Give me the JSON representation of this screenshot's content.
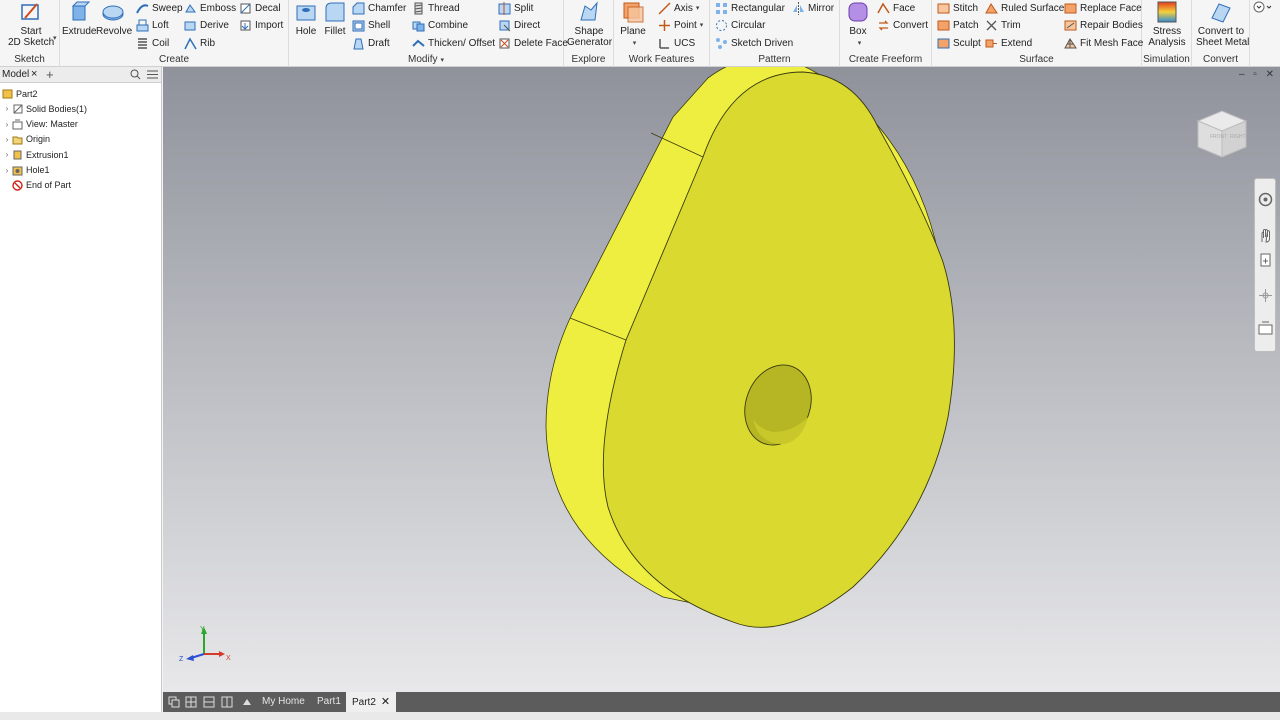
{
  "ribbon": {
    "sketch": {
      "title": "Sketch",
      "start_sketch": [
        "Start",
        "2D Sketch"
      ]
    },
    "create": {
      "title": "Create",
      "extrude": "Extrude",
      "revolve": "Revolve",
      "sweep": "Sweep",
      "loft": "Loft",
      "coil": "Coil",
      "emboss": "Emboss",
      "derive": "Derive",
      "rib": "Rib",
      "decal": "Decal",
      "import": "Import"
    },
    "modify": {
      "title": "Modify",
      "hole": "Hole",
      "fillet": "Fillet",
      "chamfer": "Chamfer",
      "shell": "Shell",
      "draft": "Draft",
      "thread": "Thread",
      "combine": "Combine",
      "thicken_offset": "Thicken/ Offset",
      "split": "Split",
      "direct": "Direct",
      "delete_face": "Delete Face"
    },
    "explore": {
      "title": "Explore",
      "shape_generator": [
        "Shape",
        "Generator"
      ]
    },
    "work_features": {
      "title": "Work Features",
      "plane": "Plane",
      "axis": "Axis",
      "point": "Point",
      "ucs": "UCS"
    },
    "pattern": {
      "title": "Pattern",
      "rectangular": "Rectangular",
      "circular": "Circular",
      "sketch_driven": "Sketch Driven",
      "mirror": "Mirror"
    },
    "create_freeform": {
      "title": "Create Freeform",
      "box": "Box",
      "face": "Face",
      "convert": "Convert"
    },
    "surface": {
      "title": "Surface",
      "stitch": "Stitch",
      "patch": "Patch",
      "sculpt": "Sculpt",
      "ruled_surface": "Ruled Surface",
      "trim": "Trim",
      "extend": "Extend",
      "replace_face": "Replace Face",
      "repair_bodies": "Repair Bodies",
      "fit_mesh_face": "Fit Mesh Face"
    },
    "simulation": {
      "title": "Simulation",
      "stress_analysis": [
        "Stress",
        "Analysis"
      ]
    },
    "convert": {
      "title": "Convert",
      "convert_to_sheet_metal": [
        "Convert to",
        "Sheet Metal"
      ]
    }
  },
  "browser": {
    "tab_label": "Model",
    "tree": [
      {
        "label": "Part2",
        "icon": "part-icon",
        "indent": 0,
        "expander": ""
      },
      {
        "label": "Solid Bodies(1)",
        "icon": "solid-bodies-icon",
        "indent": 1,
        "expander": "›"
      },
      {
        "label": "View: Master",
        "icon": "view-icon",
        "indent": 1,
        "expander": "›"
      },
      {
        "label": "Origin",
        "icon": "folder-icon",
        "indent": 1,
        "expander": "›"
      },
      {
        "label": "Extrusion1",
        "icon": "extrusion-icon",
        "indent": 1,
        "expander": "›"
      },
      {
        "label": "Hole1",
        "icon": "hole-icon",
        "indent": 1,
        "expander": "›"
      },
      {
        "label": "End of Part",
        "icon": "end-of-part-icon",
        "indent": 1,
        "expander": ""
      }
    ]
  },
  "viewcube": {
    "top": "TOP",
    "front": "FRONT",
    "right": "RIGHT"
  },
  "triad": {
    "x": "X",
    "y": "Y",
    "z": "Z"
  },
  "doc_tabs": {
    "my_home": "My Home",
    "part1": "Part1",
    "part2": "Part2"
  },
  "colors": {
    "part_face": "#d9d930",
    "part_side": "#eeee40",
    "accent": "#2b7cd3"
  }
}
